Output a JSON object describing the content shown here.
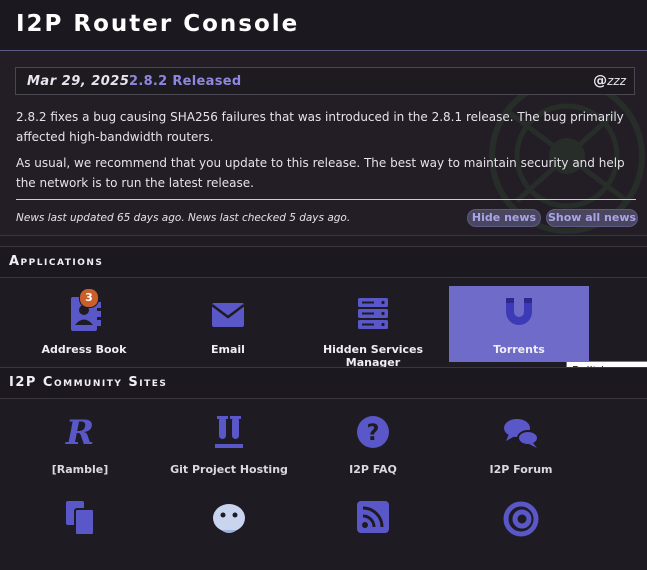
{
  "window": {
    "title": "I2P Router Console"
  },
  "news": {
    "date": "Mar 29, 2025",
    "headline": "2.8.2 Released",
    "author_prefix": "@",
    "author": "zzz",
    "paragraphs": [
      "2.8.2 fixes a bug causing SHA256 failures that was introduced in the 2.8.1 release. The bug primarily affected high-bandwidth routers.",
      "As usual, we recommend that you update to this release. The best way to maintain security and help the network is to run the latest release."
    ],
    "status": "News last updated 65 days ago. News last checked 5 days ago.",
    "hide_label": "Hide news",
    "show_all_label": "Show all news"
  },
  "applications": {
    "title": "Applications",
    "items": [
      {
        "label": "Address Book",
        "icon": "address-book-icon",
        "badge": "3"
      },
      {
        "label": "Email",
        "icon": "email-icon"
      },
      {
        "label": "Hidden Services Manager",
        "icon": "server-icon"
      },
      {
        "label": "Torrents",
        "icon": "magnet-icon",
        "active": true
      }
    ]
  },
  "tooltip": "Built-in anonymous",
  "community": {
    "title": "I2P Community Sites",
    "items": [
      {
        "label": "[Ramble]",
        "icon": "ramble-icon"
      },
      {
        "label": "Git Project Hosting",
        "icon": "git-tubes-icon"
      },
      {
        "label": "I2P FAQ",
        "icon": "question-icon"
      },
      {
        "label": "I2P Forum",
        "icon": "chat-bubbles-icon"
      },
      {
        "label": "",
        "icon": "clipboard-copy-icon"
      },
      {
        "label": "",
        "icon": "cloud-mascot-icon"
      },
      {
        "label": "",
        "icon": "rss-feed-icon"
      },
      {
        "label": "",
        "icon": "spiral-icon"
      }
    ]
  },
  "colors": {
    "accent": "#6f6bc9",
    "icon": "#5a57c9",
    "link": "#8c88e0",
    "badge": "#c95f2a"
  }
}
